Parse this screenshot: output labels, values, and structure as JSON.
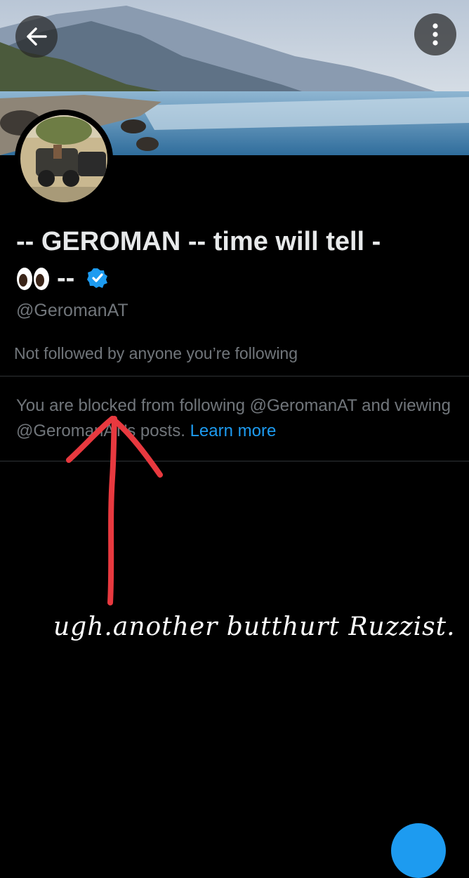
{
  "profile": {
    "display_name_line1": "-- GEROMAN -- time will tell -",
    "display_name_line2": "-- ",
    "handle": "@GeromanAT",
    "followed_by_text": "Not followed by anyone you’re following",
    "blocked_text": "You are blocked from following @GeromanAT and viewing @GeromanAT’s posts.",
    "learn_more": "Learn more"
  },
  "annotation": {
    "text": "ugh.another butthurt Ruzzist.",
    "color": "#e8393f"
  },
  "icons": {
    "back": "arrow-left-icon",
    "more": "more-vertical-icon",
    "verified": "verified-badge-icon",
    "eyes": "eyes-emoji-icon"
  },
  "colors": {
    "background": "#000000",
    "text_primary": "#e7e9ea",
    "text_secondary": "#71767b",
    "accent": "#1d9bf0",
    "divider": "#2f3336"
  }
}
